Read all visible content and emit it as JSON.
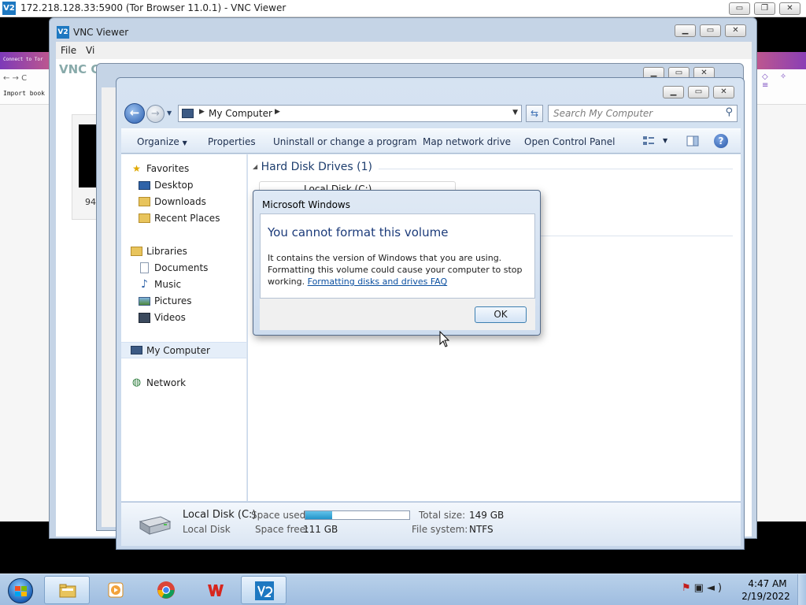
{
  "outer_window": {
    "title": "172.218.128.33:5900 (Tor Browser 11.0.1) - VNC Viewer",
    "logo": "V2",
    "buttons": {
      "minimize": "▭",
      "restore": "❐",
      "close": "✕"
    }
  },
  "background_browser": {
    "left_tab_text": "Connect to Tor",
    "import_bookmarks": "Import book",
    "nav_icons": "←  →  C"
  },
  "vnc_viewer_window": {
    "title": "VNC Viewer",
    "logo": "V2",
    "menu": [
      "File",
      "Vi"
    ],
    "brand": "VNC CO",
    "thumbnail_label": "94."
  },
  "explorer": {
    "address": {
      "crumb": "My Computer"
    },
    "search": {
      "placeholder": "Search My Computer"
    },
    "toolbar": {
      "organize": "Organize",
      "properties": "Properties",
      "uninstall": "Uninstall or change a program",
      "map_drive": "Map network drive",
      "control_panel": "Open Control Panel"
    },
    "nav": {
      "favorites": "Favorites",
      "desktop": "Desktop",
      "downloads": "Downloads",
      "recent_places": "Recent Places",
      "libraries": "Libraries",
      "documents": "Documents",
      "music": "Music",
      "pictures": "Pictures",
      "videos": "Videos",
      "my_computer": "My Computer",
      "network": "Network"
    },
    "main": {
      "group_header": "Hard Disk Drives (1)",
      "drive_name": "Local Disk (C:)"
    },
    "details": {
      "name": "Local Disk (C:)",
      "type": "Local Disk",
      "space_used_label": "Space used:",
      "space_free_label": "Space free:",
      "space_free_value": "111 GB",
      "total_size_label": "Total size:",
      "total_size_value": "149 GB",
      "filesystem_label": "File system:",
      "filesystem_value": "NTFS",
      "usage_fraction": 0.255
    }
  },
  "dialog": {
    "title": "Microsoft Windows",
    "heading": "You cannot format this volume",
    "message": "It contains the version of Windows that you are using. Formatting this volume could cause your computer to stop working.",
    "link": "Formatting disks and drives FAQ",
    "ok_label": "OK"
  },
  "taskbar": {
    "time": "4:47 AM",
    "date": "2/19/2022"
  }
}
